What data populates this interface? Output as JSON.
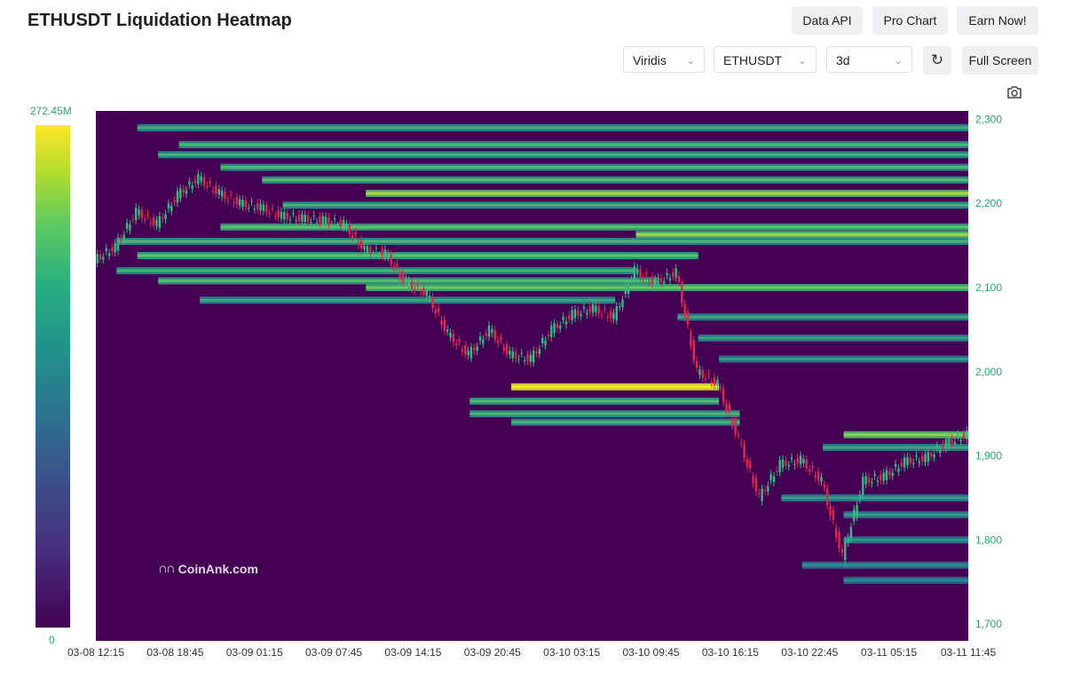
{
  "header": {
    "title": "ETHUSDT Liquidation Heatmap",
    "buttons": {
      "data_api": "Data API",
      "pro_chart": "Pro Chart",
      "earn_now": "Earn Now!",
      "full_screen": "Full Screen"
    },
    "selects": {
      "colorscale": "Viridis",
      "symbol": "ETHUSDT",
      "range": "3d"
    },
    "icons": {
      "reload": "reload-icon",
      "camera": "camera-icon",
      "chevron": "chevron-down-icon"
    }
  },
  "legend": {
    "max_label": "272.45M",
    "min_label": "0"
  },
  "watermark": {
    "text": "CoinAnk.com"
  },
  "colors": {
    "background": "#440154",
    "up": "#2ebd85",
    "down": "#e0294a",
    "accent": "#26a86a",
    "scale_low": "#440154",
    "scale_high": "#fde725"
  },
  "chart_data": {
    "type": "heatmap",
    "title": "ETHUSDT Liquidation Heatmap",
    "xlabel": "",
    "ylabel": "",
    "colorscale": "Viridis",
    "color_range": [
      0,
      272.45
    ],
    "color_unit": "M",
    "ylim": [
      1680,
      2310
    ],
    "y_ticks": [
      "2,300",
      "2,200",
      "2,100",
      "2,000",
      "1,900",
      "1,800",
      "1,700"
    ],
    "y_tick_values": [
      2300,
      2200,
      2100,
      2000,
      1900,
      1800,
      1700
    ],
    "x_ticks": [
      "03-08 12:15",
      "03-08 18:45",
      "03-09 01:15",
      "03-09 07:45",
      "03-09 14:15",
      "03-09 20:45",
      "03-10 03:15",
      "03-10 09:45",
      "03-10 16:15",
      "03-10 22:45",
      "03-11 05:15",
      "03-11 11:45"
    ],
    "price_path": [
      [
        0,
        2133
      ],
      [
        1,
        2148
      ],
      [
        2,
        2190
      ],
      [
        3,
        2175
      ],
      [
        4,
        2210
      ],
      [
        5,
        2230
      ],
      [
        6,
        2212
      ],
      [
        7,
        2200
      ],
      [
        8,
        2195
      ],
      [
        9,
        2185
      ],
      [
        10,
        2182
      ],
      [
        11,
        2180
      ],
      [
        12,
        2175
      ],
      [
        13,
        2145
      ],
      [
        14,
        2140
      ],
      [
        15,
        2105
      ],
      [
        16,
        2092
      ],
      [
        17,
        2045
      ],
      [
        18,
        2020
      ],
      [
        19,
        2050
      ],
      [
        20,
        2020
      ],
      [
        21,
        2015
      ],
      [
        22,
        2050
      ],
      [
        23,
        2068
      ],
      [
        24,
        2075
      ],
      [
        25,
        2065
      ],
      [
        26,
        2120
      ],
      [
        27,
        2105
      ],
      [
        28,
        2118
      ],
      [
        29,
        2000
      ],
      [
        30,
        1985
      ],
      [
        31,
        1920
      ],
      [
        32,
        1850
      ],
      [
        33,
        1890
      ],
      [
        34,
        1895
      ],
      [
        35,
        1870
      ],
      [
        36,
        1780
      ],
      [
        37,
        1870
      ],
      [
        38,
        1875
      ],
      [
        39,
        1893
      ],
      [
        40,
        1897
      ],
      [
        41,
        1915
      ],
      [
        42,
        1925
      ]
    ],
    "liquidation_bands": [
      {
        "price": 2290,
        "level": 0.48,
        "from": 2,
        "to": 42
      },
      {
        "price": 2270,
        "level": 0.52,
        "from": 4,
        "to": 42
      },
      {
        "price": 2258,
        "level": 0.5,
        "from": 3,
        "to": 42
      },
      {
        "price": 2243,
        "level": 0.52,
        "from": 6,
        "to": 42
      },
      {
        "price": 2228,
        "level": 0.55,
        "from": 8,
        "to": 42
      },
      {
        "price": 2212,
        "level": 0.72,
        "from": 13,
        "to": 42
      },
      {
        "price": 2198,
        "level": 0.5,
        "from": 9,
        "to": 42
      },
      {
        "price": 2172,
        "level": 0.58,
        "from": 6,
        "to": 42
      },
      {
        "price": 2163,
        "level": 0.7,
        "from": 26,
        "to": 42
      },
      {
        "price": 2155,
        "level": 0.52,
        "from": 1,
        "to": 42
      },
      {
        "price": 2138,
        "level": 0.58,
        "from": 2,
        "to": 29
      },
      {
        "price": 2120,
        "level": 0.5,
        "from": 1,
        "to": 26
      },
      {
        "price": 2108,
        "level": 0.55,
        "from": 3,
        "to": 27
      },
      {
        "price": 2100,
        "level": 0.62,
        "from": 13,
        "to": 42
      },
      {
        "price": 2085,
        "level": 0.45,
        "from": 5,
        "to": 25
      },
      {
        "price": 2065,
        "level": 0.45,
        "from": 28,
        "to": 42
      },
      {
        "price": 2040,
        "level": 0.42,
        "from": 29,
        "to": 42
      },
      {
        "price": 2015,
        "level": 0.4,
        "from": 30,
        "to": 42
      },
      {
        "price": 1982,
        "level": 0.95,
        "from": 20,
        "to": 30
      },
      {
        "price": 1965,
        "level": 0.55,
        "from": 18,
        "to": 30
      },
      {
        "price": 1950,
        "level": 0.52,
        "from": 18,
        "to": 31
      },
      {
        "price": 1940,
        "level": 0.5,
        "from": 20,
        "to": 31
      },
      {
        "price": 1925,
        "level": 0.68,
        "from": 36,
        "to": 42
      },
      {
        "price": 1910,
        "level": 0.45,
        "from": 35,
        "to": 42
      },
      {
        "price": 1850,
        "level": 0.42,
        "from": 33,
        "to": 42
      },
      {
        "price": 1830,
        "level": 0.4,
        "from": 36,
        "to": 42
      },
      {
        "price": 1800,
        "level": 0.38,
        "from": 36,
        "to": 42
      },
      {
        "price": 1770,
        "level": 0.36,
        "from": 34,
        "to": 42
      },
      {
        "price": 1752,
        "level": 0.34,
        "from": 36,
        "to": 42
      }
    ]
  }
}
